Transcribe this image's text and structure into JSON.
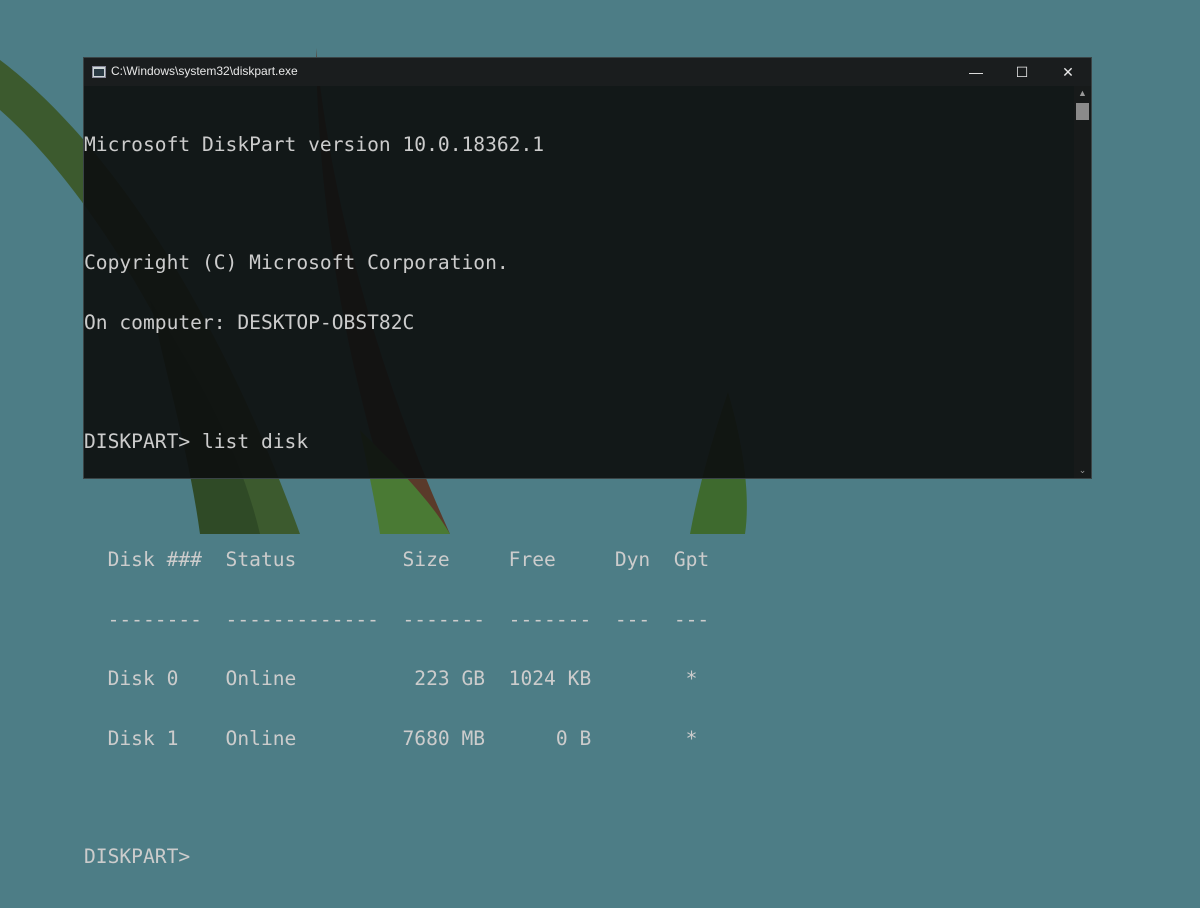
{
  "window": {
    "title": "C:\\Windows\\system32\\diskpart.exe",
    "controls": {
      "minimize": "—",
      "maximize": "☐",
      "close": "✕"
    }
  },
  "console": {
    "lines": [
      "Microsoft DiskPart version 10.0.18362.1",
      "",
      "Copyright (C) Microsoft Corporation.",
      "On computer: DESKTOP-OBST82C",
      "",
      "DISKPART> list disk",
      "",
      "  Disk ###  Status         Size     Free     Dyn  Gpt",
      "  --------  -------------  -------  -------  ---  ---",
      "  Disk 0    Online          223 GB  1024 KB        *",
      "  Disk 1    Online         7680 MB      0 B        *",
      "",
      "DISKPART> "
    ]
  },
  "colors": {
    "terminal_bg": "#0e1010",
    "terminal_text": "#cccccc",
    "desktop": "#4d7d86"
  }
}
